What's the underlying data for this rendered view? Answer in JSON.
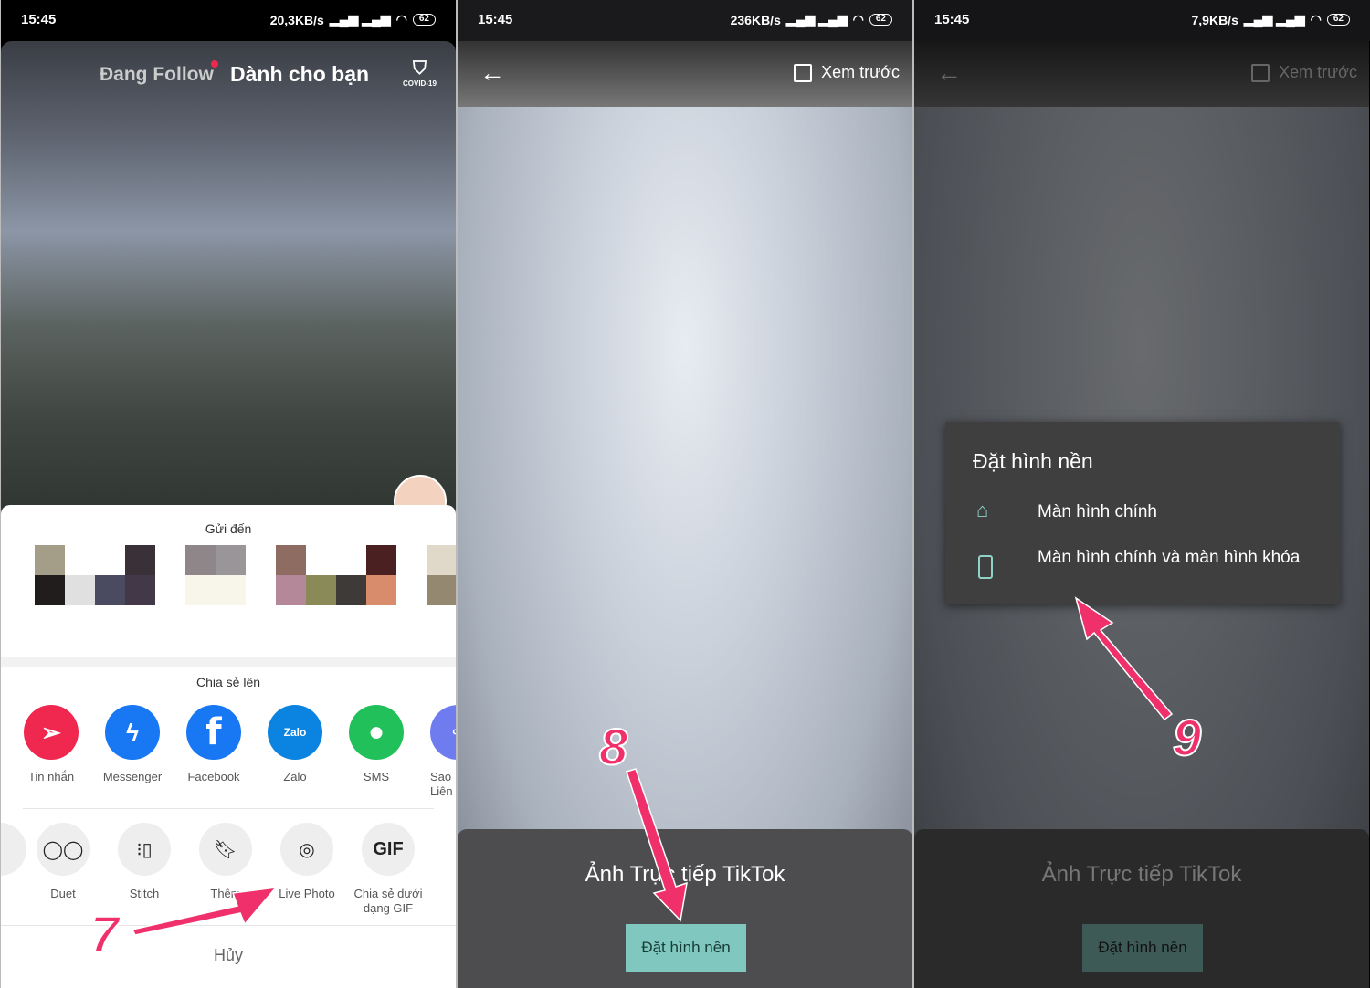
{
  "panel1": {
    "status": {
      "time": "15:45",
      "speed": "20,3KB/s",
      "battery": "62"
    },
    "header": {
      "following": "Đang Follow",
      "for_you": "Dành cho bạn",
      "covid": "COVID-19"
    },
    "sheet": {
      "send_to": "Gửi đến",
      "share_to": "Chia sẻ lên",
      "apps": [
        {
          "label": "Tin nhắn",
          "color": "#f0284f"
        },
        {
          "label": "Messenger",
          "color": "#1877f2"
        },
        {
          "label": "Facebook",
          "color": "#1877f2"
        },
        {
          "label": "Zalo",
          "color": "#0a84e0",
          "glyph": "Zalo"
        },
        {
          "label": "SMS",
          "color": "#22c05a"
        },
        {
          "label": "Sao Liên",
          "color": "#6f7cf0"
        }
      ],
      "actions": [
        {
          "label": "Duet",
          "icon": "duet-icon"
        },
        {
          "label": "Stitch",
          "icon": "stitch-icon"
        },
        {
          "label": "Thêm",
          "icon": "bookmark-icon"
        },
        {
          "label": "Live Photo",
          "icon": "live-photo-icon"
        },
        {
          "label": "Chia sẻ dưới dạng GIF",
          "icon": "gif-icon",
          "glyph": "GIF"
        }
      ],
      "cancel": "Hủy"
    },
    "step": "7"
  },
  "panel2": {
    "status": {
      "time": "15:45",
      "speed": "236KB/s",
      "battery": "62"
    },
    "preview": "Xem trước",
    "title": "Ảnh Trực tiếp TikTok",
    "button": "Đặt hình nền",
    "step": "8"
  },
  "panel3": {
    "status": {
      "time": "15:45",
      "speed": "7,9KB/s",
      "battery": "62"
    },
    "preview": "Xem trước",
    "title": "Ảnh Trực tiếp TikTok",
    "button": "Đặt hình nền",
    "dialog": {
      "title": "Đặt hình nền",
      "options": [
        {
          "label": "Màn hình chính",
          "icon": "home-icon"
        },
        {
          "label": "Màn hình chính và màn hình khóa",
          "icon": "phone-icon"
        }
      ]
    },
    "step": "9"
  },
  "colors": {
    "accent": "#f0306a",
    "button": "#80c8bf"
  }
}
